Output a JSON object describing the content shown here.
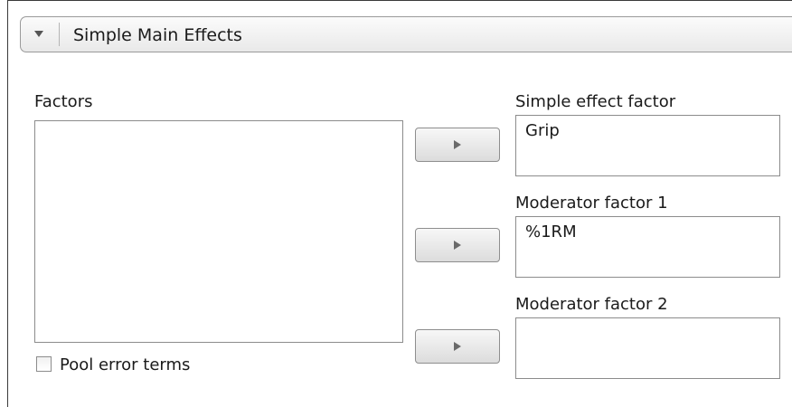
{
  "panel": {
    "title": "Simple Main Effects",
    "collapse_icon": "triangle-down-icon"
  },
  "factors": {
    "label": "Factors",
    "items": []
  },
  "simple_effect": {
    "label": "Simple effect factor",
    "value": "Grip"
  },
  "moderator_1": {
    "label": "Moderator factor 1",
    "value": "%1RM"
  },
  "moderator_2": {
    "label": "Moderator factor 2",
    "value": ""
  },
  "pool_error": {
    "label": "Pool error terms",
    "checked": false
  },
  "move_icon": "play-arrow-icon"
}
